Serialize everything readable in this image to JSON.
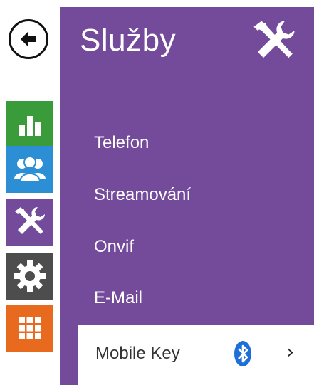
{
  "panel": {
    "title": "Služby",
    "title_icon": "tools-icon",
    "background_color": "#744a9a"
  },
  "rail": {
    "back_icon": "arrow-left-icon",
    "tiles": [
      {
        "name": "status",
        "icon": "bar-chart-icon",
        "color": "#3a9b3a"
      },
      {
        "name": "users",
        "icon": "users-icon",
        "color": "#2c8fd6"
      },
      {
        "name": "services",
        "icon": "tools-icon",
        "color": "#744a9a"
      },
      {
        "name": "system",
        "icon": "gear-icon",
        "color": "#4d4d4d"
      },
      {
        "name": "apps",
        "icon": "grid-icon",
        "color": "#e86a1f"
      }
    ]
  },
  "menu": {
    "items": [
      {
        "label": "Telefon"
      },
      {
        "label": "Streamování"
      },
      {
        "label": "Onvif"
      },
      {
        "label": "E-Mail"
      }
    ],
    "selected": {
      "label": "Mobile Key",
      "icon": "bluetooth-icon",
      "chevron": "›"
    }
  }
}
